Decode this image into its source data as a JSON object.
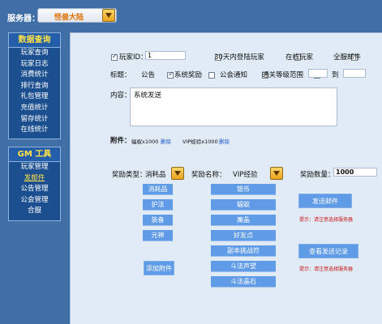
{
  "header": {
    "server_label": "服务器：",
    "server_value": "怪兽大陆"
  },
  "sidebar": {
    "section1_title": "数据查询",
    "section1_items": [
      "玩家查询",
      "玩家日志",
      "消费统计",
      "排行查询",
      "礼包管理",
      "充值统计",
      "留存统计",
      "在线统计"
    ],
    "section2_title": "GM 工具",
    "section2_items": [
      "玩家管理",
      "发邮件",
      "公告管理",
      "公会管理",
      "合服"
    ],
    "active_item": "发邮件"
  },
  "form": {
    "player_id_label": "玩家ID：",
    "player_id_value": "1",
    "login_30d_label": "30天内登陆玩家",
    "online_label": "在线玩家",
    "all_mail_label": "全服邮件",
    "title_label": "标题：",
    "title_opt_notice": "公告",
    "title_opt_reward": "系统奖励",
    "title_opt_guild": "公会通知",
    "title_opt_clear": "通关等级范围",
    "range_to": "到",
    "content_label": "内容：",
    "content_value": "系统发送",
    "attach_label": "附件：",
    "attach_item1": "蝠蚁x1000",
    "attach_item2": "VIP经验x1000",
    "remove_link": "删除",
    "reward_type_label": "奖励类型：",
    "reward_type_value": "消耗品",
    "reward_name_label": "奖励名称：",
    "reward_name_value": "VIP经验",
    "reward_qty_label": "奖励数量：",
    "reward_qty_value": "1000"
  },
  "reward_types": [
    "消耗品",
    "护法",
    "装备",
    "元神"
  ],
  "add_attach_button": "添加附件",
  "reward_names": [
    "银币",
    "蝠蚁",
    "魔晶",
    "好友点",
    "副本挑战符",
    "斗法声望",
    "斗法晶石"
  ],
  "send_mail_button": "发送邮件",
  "view_record_button": "查看发送记录",
  "tip_text": "提示：请注意选择服务器",
  "colors": {
    "background": "#3f6fa6",
    "panel": "#e0ebf6",
    "button": "#5f9be6",
    "accent_yellow": "#ffe24a",
    "tip_red": "#cc1010"
  }
}
